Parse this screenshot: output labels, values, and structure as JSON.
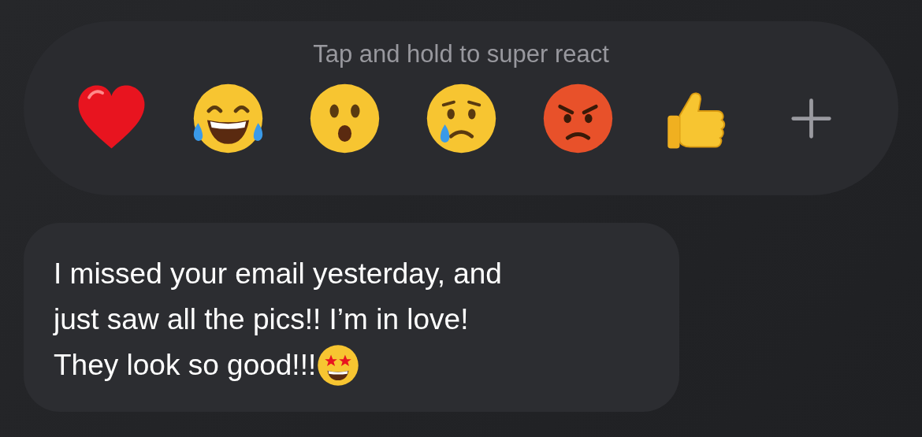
{
  "reaction_bar": {
    "hint": "Tap and hold to super react",
    "reactions": [
      {
        "kind": "heart"
      },
      {
        "kind": "joy"
      },
      {
        "kind": "wow"
      },
      {
        "kind": "sad"
      },
      {
        "kind": "angry"
      },
      {
        "kind": "thumbs"
      },
      {
        "kind": "more"
      }
    ]
  },
  "message": {
    "lines": [
      "I missed your email yesterday, and",
      "just saw all the pics!! I’m in love!",
      "They look so good!!!"
    ]
  }
}
